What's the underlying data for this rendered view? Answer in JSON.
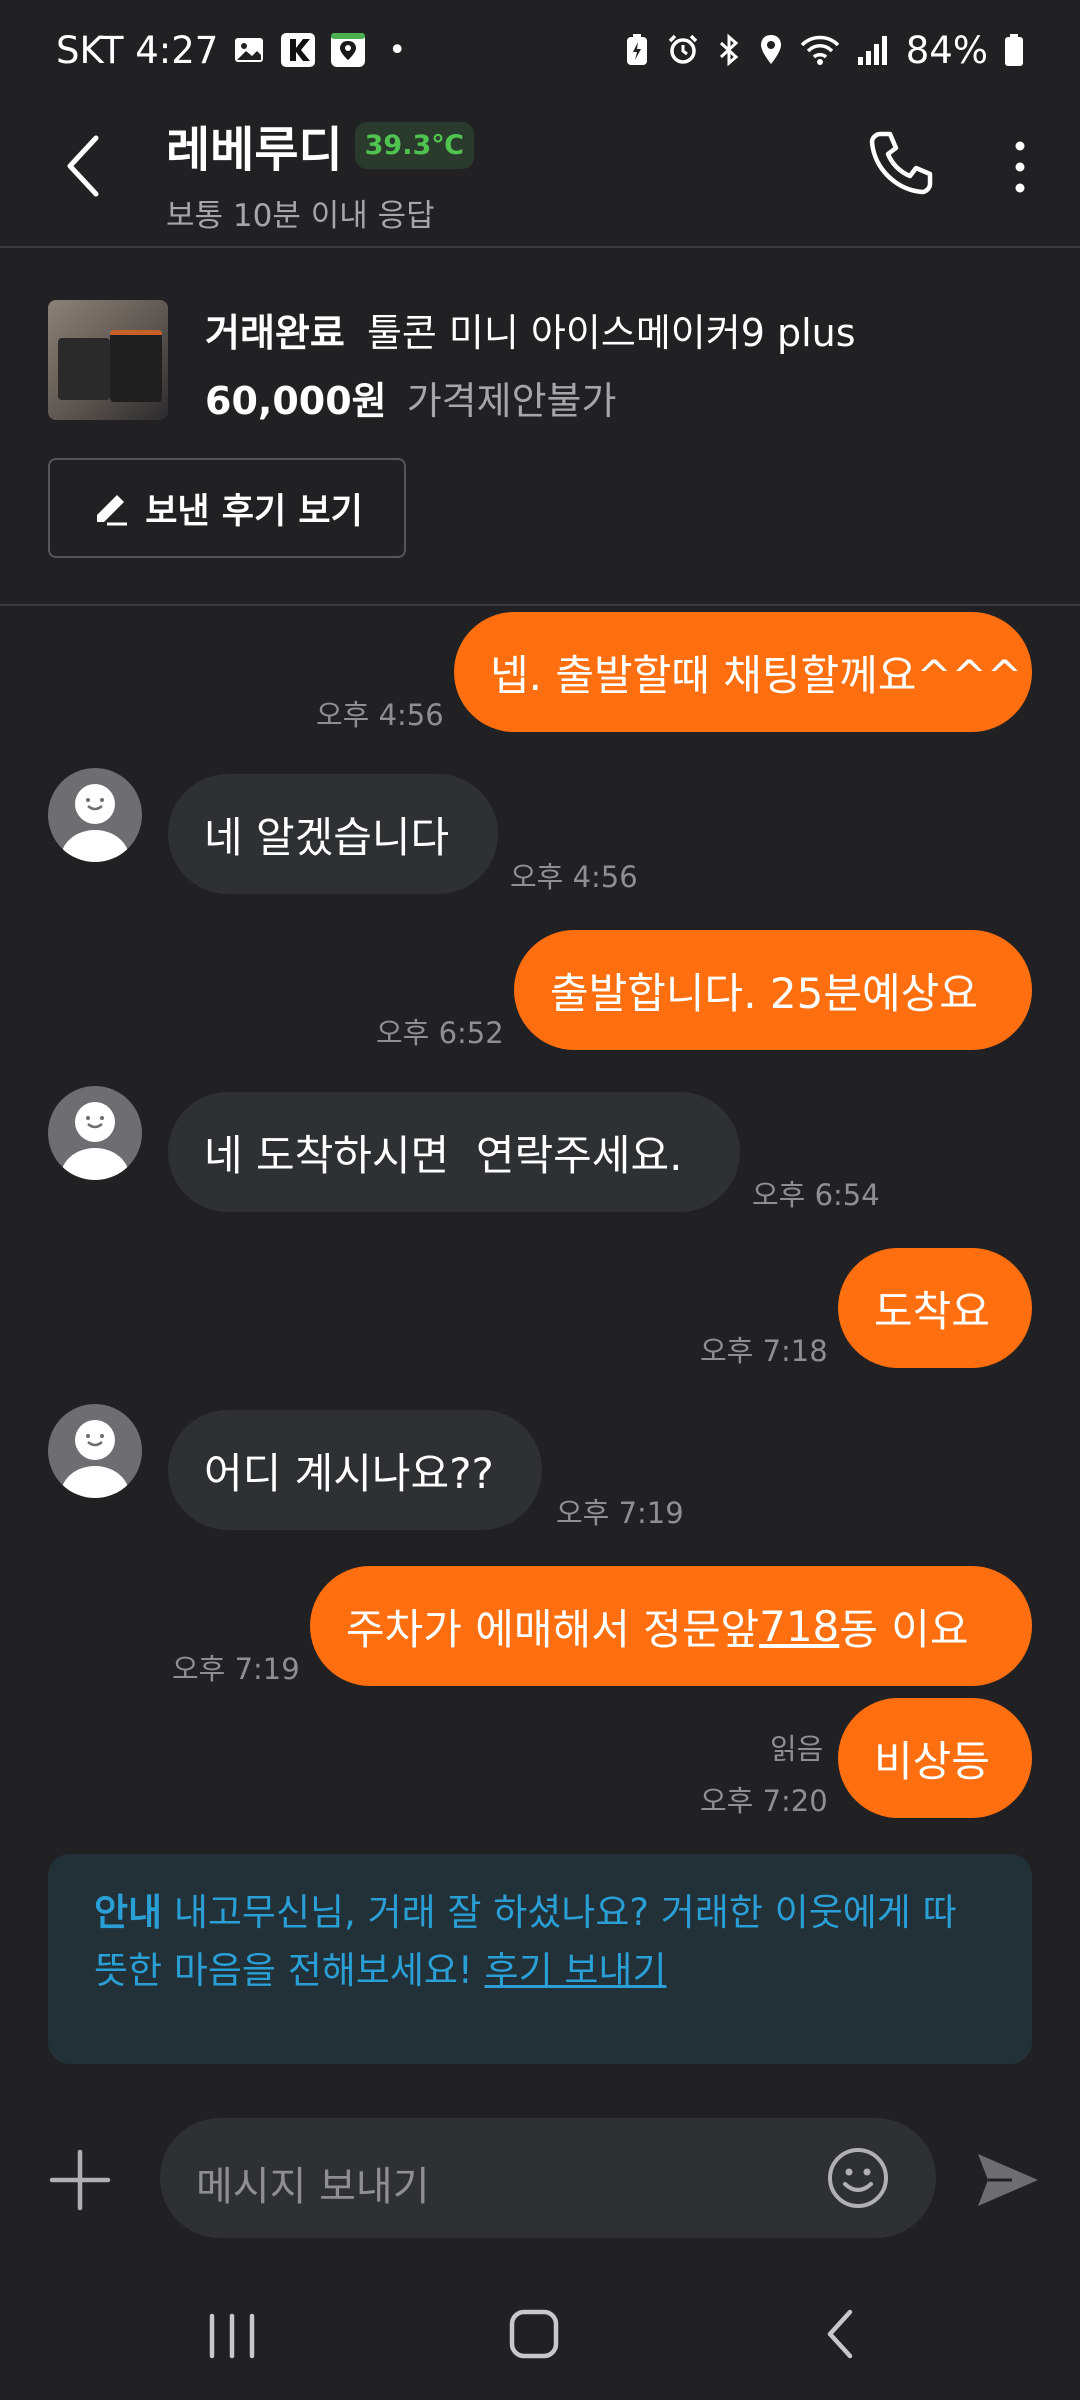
{
  "status_bar": {
    "carrier_time": "SKT 4:27",
    "battery": "84%"
  },
  "header": {
    "name": "레베루디",
    "temperature": "39.3℃",
    "response": "보통 10분 이내 응답"
  },
  "product": {
    "status": "거래완료",
    "title": "툴콘 미니 아이스메이커9 plus",
    "price": "60,000원",
    "negotiation": "가격제안불가",
    "review_button": "보낸 후기 보기"
  },
  "messages": [
    {
      "side": "out",
      "text": "넵. 출발할때 채팅할께요^^^",
      "time": "오후 4:56"
    },
    {
      "side": "in",
      "text": "네 알겠습니다",
      "time": "오후 4:56"
    },
    {
      "side": "out",
      "text": "출발합니다. 25분예상요",
      "time": "오후 6:52"
    },
    {
      "side": "in",
      "text": "네 도착하시면  연락주세요.",
      "time": "오후 6:54"
    },
    {
      "side": "out",
      "text": "도착요",
      "time": "오후 7:18"
    },
    {
      "side": "in",
      "text": "어디 계시나요??",
      "time": "오후 7:19"
    },
    {
      "side": "out",
      "text_before": "주차가 에매해서 정문앞",
      "text_link": "718",
      "text_after": "동 이요",
      "time": "오후 7:19"
    },
    {
      "side": "out",
      "text": "비상등",
      "time": "오후 7:20",
      "read": "읽음"
    }
  ],
  "notice": {
    "label": "안내",
    "text": " 내고무신님, 거래 잘 하셨나요? 거래한 이웃에게 따뜻한 마음을 전해보세요! ",
    "link": "후기 보내기"
  },
  "input": {
    "placeholder": "메시지 보내기"
  },
  "colors": {
    "background": "#212124",
    "accent_orange": "#ff6f0f",
    "incoming_bubble": "#2f3034",
    "temperature_green": "#4fc24f",
    "notice_blue": "#2a9fd6"
  }
}
